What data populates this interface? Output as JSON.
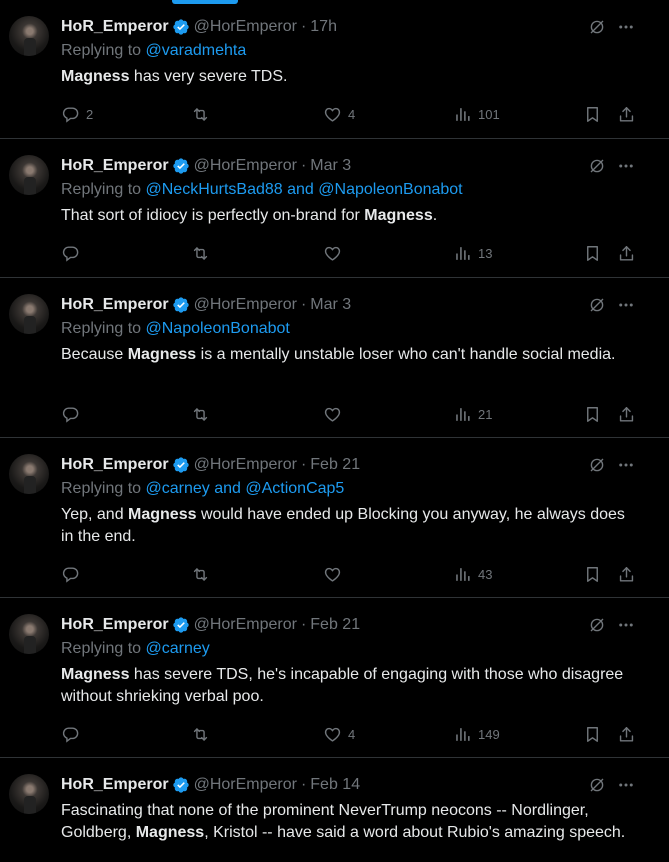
{
  "tweets": [
    {
      "name": "HoR_Emperor",
      "handle": "@HorEmperor",
      "time": "17h",
      "reply_prefix": "Replying to ",
      "reply_to": "@varadmehta",
      "body": [
        {
          "b": "Magness"
        },
        {
          "t": " has very severe TDS."
        }
      ],
      "replies": "2",
      "reposts": "",
      "likes": "4",
      "views": "101"
    },
    {
      "name": "HoR_Emperor",
      "handle": "@HorEmperor",
      "time": "Mar 3",
      "reply_prefix": "Replying to ",
      "reply_to": "@NeckHurtsBad88 and @NapoleonBonabot",
      "body": [
        {
          "t": "That sort of idiocy is perfectly on-brand for "
        },
        {
          "b": "Magness"
        },
        {
          "t": "."
        }
      ],
      "replies": "",
      "reposts": "",
      "likes": "",
      "views": "13"
    },
    {
      "name": "HoR_Emperor",
      "handle": "@HorEmperor",
      "time": "Mar 3",
      "reply_prefix": "Replying to ",
      "reply_to": "@NapoleonBonabot",
      "body": [
        {
          "t": "Because "
        },
        {
          "b": "Magness"
        },
        {
          "t": " is a mentally unstable loser who can't handle social media."
        }
      ],
      "replies": "",
      "reposts": "",
      "likes": "",
      "views": "21"
    },
    {
      "name": "HoR_Emperor",
      "handle": "@HorEmperor",
      "time": "Feb 21",
      "reply_prefix": "Replying to ",
      "reply_to": "@carney and @ActionCap5",
      "body": [
        {
          "t": "Yep,  and "
        },
        {
          "b": "Magness"
        },
        {
          "t": " would have ended up Blocking you anyway, he always does in the end."
        }
      ],
      "replies": "",
      "reposts": "",
      "likes": "",
      "views": "43"
    },
    {
      "name": "HoR_Emperor",
      "handle": "@HorEmperor",
      "time": "Feb 21",
      "reply_prefix": "Replying to ",
      "reply_to": "@carney",
      "body": [
        {
          "b": "Magness"
        },
        {
          "t": " has severe TDS, he's incapable of engaging with those who disagree without shrieking verbal poo."
        }
      ],
      "replies": "",
      "reposts": "",
      "likes": "4",
      "views": "149"
    },
    {
      "name": "HoR_Emperor",
      "handle": "@HorEmperor",
      "time": "Feb 14",
      "reply_prefix": "",
      "reply_to": "",
      "body": [
        {
          "t": "Fascinating that none of the prominent NeverTrump neocons -- Nordlinger, Goldberg, "
        },
        {
          "b": "Magness"
        },
        {
          "t": ", Kristol -- have said a word about Rubio's amazing speech."
        }
      ],
      "replies": "",
      "reposts": "",
      "likes": "",
      "views": ""
    }
  ],
  "dot": "·",
  "colors": {
    "accent": "#1d9bf0",
    "muted": "#71767b",
    "text": "#e7e9ea",
    "border": "#2f3336",
    "background": "#000000"
  },
  "icons": [
    "verified-badge-icon",
    "grok-icon",
    "more-icon",
    "reply-icon",
    "repost-icon",
    "like-icon",
    "views-icon",
    "bookmark-icon",
    "share-icon"
  ]
}
